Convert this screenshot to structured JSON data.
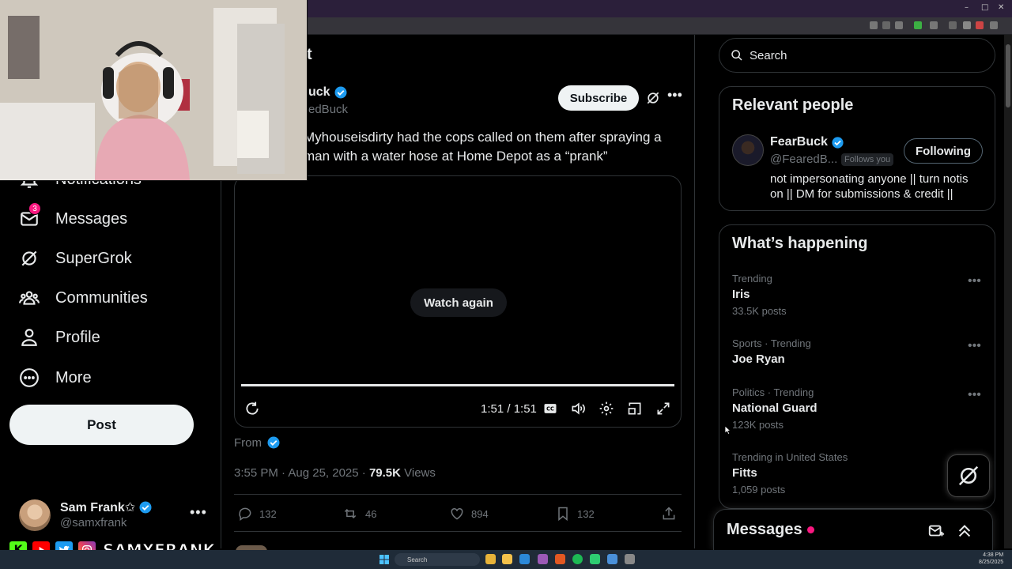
{
  "browser": {
    "window_controls": [
      "–",
      "□",
      "✕"
    ]
  },
  "nav": {
    "items": [
      {
        "label": "Notifications",
        "icon": "bell-icon"
      },
      {
        "label": "Messages",
        "icon": "envelope-icon",
        "badge": "3"
      },
      {
        "label": "SuperGrok",
        "icon": "grok-icon"
      },
      {
        "label": "Communities",
        "icon": "communities-icon"
      },
      {
        "label": "Profile",
        "icon": "person-icon"
      },
      {
        "label": "More",
        "icon": "more-circle-icon"
      }
    ],
    "post_label": "Post"
  },
  "account": {
    "name": "Sam Frank✩",
    "handle": "@samxfrank"
  },
  "post": {
    "page_title": "t",
    "author_name": "uck",
    "author_handle": "edBuck",
    "subscribe_label": "Subscribe",
    "text": "Myhouseisdirty had the cops called on them after spraying a man with a water hose at Home Depot as a “prank”",
    "video": {
      "watch_again": "Watch again",
      "time": "1:51 / 1:51",
      "progress": 1.0
    },
    "from_label": "From",
    "timestamp": "3:55 PM · Aug 25, 2025 · ",
    "views_count": "79.5K",
    "views_label": " Views",
    "actions": {
      "replies": "132",
      "reposts": "46",
      "likes": "894",
      "bookmarks": "132"
    }
  },
  "search": {
    "placeholder": "Search"
  },
  "relevant_people": {
    "title": "Relevant people",
    "person": {
      "name": "FearBuck",
      "handle": "@FearedB...",
      "follows_you": "Follows you",
      "button": "Following",
      "bio": "not impersonating anyone || turn notis on || DM for submissions & credit ||"
    }
  },
  "whats_happening": {
    "title": "What’s happening",
    "trends": [
      {
        "context": "Trending",
        "title": "Iris",
        "count": "33.5K posts"
      },
      {
        "context": "Sports · Trending",
        "title": "Joe Ryan",
        "count": ""
      },
      {
        "context": "Politics · Trending",
        "title": "National Guard",
        "count": "123K posts"
      },
      {
        "context": "Trending in United States",
        "title": "Fitts",
        "count": "1,059 posts"
      }
    ]
  },
  "messages_drawer": {
    "title": "Messages"
  },
  "overlay": {
    "social_letters": [
      "K"
    ],
    "handle": "SAMXFRANK"
  },
  "taskbar": {
    "search_label": "Search",
    "time": "4:38 PM",
    "date": "8/25/2025"
  },
  "colors": {
    "accent_blue": "#1d9bf0",
    "badge_pink": "#f91880",
    "text_primary": "#e7e9ea",
    "text_secondary": "#71767b"
  }
}
